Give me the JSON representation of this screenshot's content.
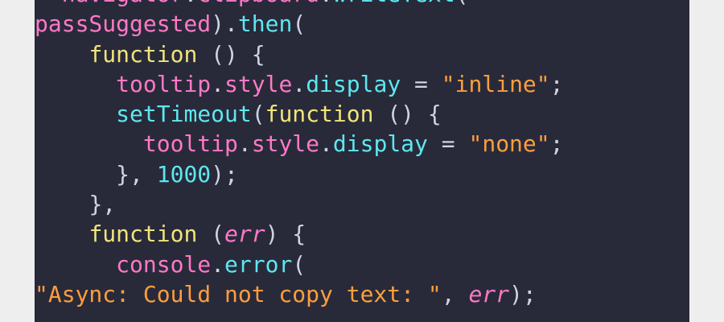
{
  "editor": {
    "lines": [
      {
        "indent": "  ",
        "tokens": [
          {
            "t": "navigator",
            "k": "obj"
          },
          {
            "t": ".",
            "k": "dot"
          },
          {
            "t": "clipboard",
            "k": "obj"
          },
          {
            "t": ".",
            "k": "dot"
          },
          {
            "t": "writeText",
            "k": "method"
          },
          {
            "t": "(",
            "k": "punc"
          }
        ]
      },
      {
        "indent": "",
        "tokens": [
          {
            "t": "passSuggested",
            "k": "obj"
          },
          {
            "t": ").",
            "k": "punc"
          },
          {
            "t": "then",
            "k": "method"
          },
          {
            "t": "(",
            "k": "punc"
          }
        ]
      },
      {
        "indent": "    ",
        "tokens": [
          {
            "t": "function",
            "k": "kw"
          },
          {
            "t": " () {",
            "k": "punc"
          }
        ]
      },
      {
        "indent": "      ",
        "tokens": [
          {
            "t": "tooltip",
            "k": "obj"
          },
          {
            "t": ".",
            "k": "dot"
          },
          {
            "t": "style",
            "k": "obj"
          },
          {
            "t": ".",
            "k": "dot"
          },
          {
            "t": "display",
            "k": "method"
          },
          {
            "t": " = ",
            "k": "punc"
          },
          {
            "t": "\"inline\"",
            "k": "str"
          },
          {
            "t": ";",
            "k": "punc"
          }
        ]
      },
      {
        "indent": "      ",
        "tokens": [
          {
            "t": "setTimeout",
            "k": "method"
          },
          {
            "t": "(",
            "k": "punc"
          },
          {
            "t": "function",
            "k": "kw"
          },
          {
            "t": " () {",
            "k": "punc"
          }
        ]
      },
      {
        "indent": "        ",
        "tokens": [
          {
            "t": "tooltip",
            "k": "obj"
          },
          {
            "t": ".",
            "k": "dot"
          },
          {
            "t": "style",
            "k": "obj"
          },
          {
            "t": ".",
            "k": "dot"
          },
          {
            "t": "display",
            "k": "method"
          },
          {
            "t": " = ",
            "k": "punc"
          },
          {
            "t": "\"none\"",
            "k": "str"
          },
          {
            "t": ";",
            "k": "punc"
          }
        ]
      },
      {
        "indent": "      ",
        "tokens": [
          {
            "t": "}, ",
            "k": "punc"
          },
          {
            "t": "1000",
            "k": "num"
          },
          {
            "t": ");",
            "k": "punc"
          }
        ]
      },
      {
        "indent": "    ",
        "tokens": [
          {
            "t": "},",
            "k": "punc"
          }
        ]
      },
      {
        "indent": "    ",
        "tokens": [
          {
            "t": "function",
            "k": "kw"
          },
          {
            "t": " (",
            "k": "punc"
          },
          {
            "t": "err",
            "k": "param"
          },
          {
            "t": ") {",
            "k": "punc"
          }
        ]
      },
      {
        "indent": "      ",
        "tokens": [
          {
            "t": "console",
            "k": "obj"
          },
          {
            "t": ".",
            "k": "dot"
          },
          {
            "t": "error",
            "k": "method"
          },
          {
            "t": "(",
            "k": "punc"
          }
        ]
      },
      {
        "indent": "",
        "tokens": [
          {
            "t": "\"Async: Could not copy text: \"",
            "k": "str"
          },
          {
            "t": ", ",
            "k": "punc"
          },
          {
            "t": "err",
            "k": "param"
          },
          {
            "t": ");",
            "k": "punc"
          }
        ]
      }
    ]
  },
  "theme": {
    "background": "#282a3a",
    "page_background": "#eeeeee",
    "keyword": "#f1e47b",
    "object": "#ff79c6",
    "method": "#5ee7f0",
    "string": "#ff9e3d",
    "number": "#5ee7f0",
    "punctuation": "#cfd2e6"
  }
}
